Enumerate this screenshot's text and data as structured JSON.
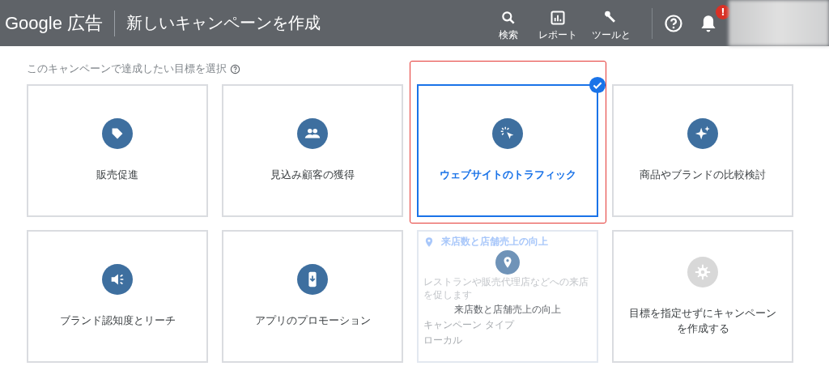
{
  "header": {
    "logo": "Google 広告",
    "title": "新しいキャンペーンを作成",
    "tools": [
      {
        "label": "検索"
      },
      {
        "label": "レポート"
      },
      {
        "label": "ツールと"
      }
    ],
    "alert_badge": "!"
  },
  "prompt": "このキャンペーンで達成したい目標を選択",
  "goals": [
    {
      "kind": "goal",
      "label": "販売促進",
      "selected": false
    },
    {
      "kind": "goal",
      "label": "見込み顧客の獲得",
      "selected": false
    },
    {
      "kind": "goal",
      "label": "ウェブサイトのトラフィック",
      "selected": true
    },
    {
      "kind": "goal",
      "label": "商品やブランドの比較検討",
      "selected": false
    },
    {
      "kind": "goal",
      "label": "ブランド認知度とリーチ",
      "selected": false
    },
    {
      "kind": "goal",
      "label": "アプリのプロモーション",
      "selected": false
    },
    {
      "kind": "hover",
      "label": "来店数と店舗売上の向上",
      "selected": false,
      "tooltip": {
        "title": "来店数と店舗売上の向上",
        "description": "レストランや販売代理店などへの来店を促します",
        "type_label": "キャンペーン タイプ",
        "type_value": "ローカル"
      }
    },
    {
      "kind": "neutral",
      "label": "目標を指定せずにキャンペーンを作成する",
      "selected": false
    }
  ]
}
